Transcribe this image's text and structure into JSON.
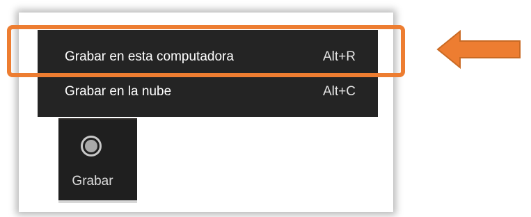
{
  "menu": {
    "items": [
      {
        "label": "Grabar en esta computadora",
        "shortcut": "Alt+R"
      },
      {
        "label": "Grabar en la nube",
        "shortcut": "Alt+C"
      }
    ]
  },
  "toolbar": {
    "record_button": {
      "label": "Grabar",
      "icon": "record-icon"
    }
  },
  "annotation": {
    "highlight_color": "#ED7D31",
    "arrow_color": "#ED7D31",
    "arrow_direction": "left"
  },
  "colors": {
    "menu_background": "#242424",
    "menu_text": "#FFFFFF",
    "button_background": "#1F1F1F"
  }
}
